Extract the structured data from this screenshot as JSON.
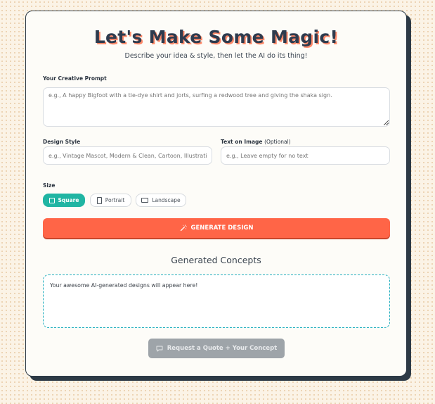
{
  "header": {
    "title": "Let's Make Some Magic!",
    "subtitle": "Describe your idea & style, then let the AI do its thing!"
  },
  "form": {
    "prompt_label": "Your Creative Prompt",
    "prompt_placeholder": "e.g., A happy Bigfoot with a tie-dye shirt and jorts, surfing a redwood tree and giving the shaka sign.",
    "style_label": "Design Style",
    "style_placeholder": "e.g., Vintage Mascot, Modern & Clean, Cartoon, Illustration",
    "text_label": "Text on Image",
    "text_label_optional": "(Optional)",
    "text_placeholder": "e.g., Leave empty for no text",
    "size_label": "Size",
    "sizes": [
      {
        "label": "Square",
        "selected": true
      },
      {
        "label": "Portrait",
        "selected": false
      },
      {
        "label": "Landscape",
        "selected": false
      }
    ],
    "generate_label": "GENERATE DESIGN"
  },
  "results": {
    "title": "Generated Concepts",
    "empty_text": "Your awesome AI-generated designs will appear here!"
  },
  "quote_button_label": "Request a Quote + Your Concept",
  "colors": {
    "accent_teal": "#20b5a3",
    "generate_orange": "#ff6547",
    "disabled_gray": "#9ea4a9"
  },
  "icons": {
    "generate": "magic-wand-icon",
    "quote": "chat-bubble-icon",
    "square": "square-icon",
    "portrait": "portrait-icon",
    "landscape": "landscape-icon"
  }
}
